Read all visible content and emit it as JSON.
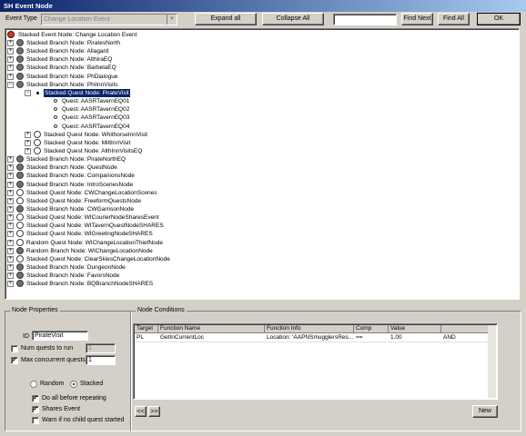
{
  "window": {
    "title": "SH Event Node"
  },
  "toolbar": {
    "event_type_label": "Event Type",
    "event_type_value": "Change Location Event",
    "expand_all": "Expand all",
    "collapse_all": "Collapse All",
    "search_value": "",
    "find_next": "Find Next",
    "find_all": "Find All",
    "ok": "OK"
  },
  "tree": {
    "root": "Stacked Event Node: Change Location Event",
    "items": [
      {
        "label": "Stacked Branch Node: PiratesNorth",
        "level": 1,
        "expander": "+",
        "icon": "filled"
      },
      {
        "label": "Stacked Branch Node: Allagard",
        "level": 1,
        "expander": "+",
        "icon": "filled"
      },
      {
        "label": "Stacked Branch Node: AlthiraEQ",
        "level": 1,
        "expander": "+",
        "icon": "filled"
      },
      {
        "label": "Stacked Branch Node: BarbelaEQ",
        "level": 1,
        "expander": "+",
        "icon": "filled"
      },
      {
        "label": "Stacked Branch Node: PhDialogue",
        "level": 1,
        "expander": "+",
        "icon": "filled"
      },
      {
        "label": "Stacked Branch Node: PhiInnVisits",
        "level": 1,
        "expander": "-",
        "icon": "filled"
      },
      {
        "label": "Stacked Quest Node: PirateVisit",
        "level": 2,
        "expander": "-",
        "icon": "dot",
        "selected": true
      },
      {
        "label": "Quest: AASRTavernEQ01",
        "level": 3,
        "expander": "",
        "icon": "small"
      },
      {
        "label": "Quest: AASRTavernEQ02",
        "level": 3,
        "expander": "",
        "icon": "small"
      },
      {
        "label": "Quest: AASRTavernEQ03",
        "level": 3,
        "expander": "",
        "icon": "small"
      },
      {
        "label": "Quest: AASRTavernEQ04",
        "level": 3,
        "expander": "",
        "icon": "small"
      },
      {
        "label": "Stacked Quest Node: WhithorseInnVisit",
        "level": 2,
        "expander": "+",
        "icon": "empty"
      },
      {
        "label": "Stacked Quest Node: MittInnVisit",
        "level": 2,
        "expander": "+",
        "icon": "empty"
      },
      {
        "label": "Stacked Quest Node: AlthInnVisitsEQ",
        "level": 2,
        "expander": "+",
        "icon": "empty"
      },
      {
        "label": "Stacked Branch Node: PirateNorthEQ",
        "level": 1,
        "expander": "+",
        "icon": "filled"
      },
      {
        "label": "Stacked Branch Node: QuestNode",
        "level": 1,
        "expander": "+",
        "icon": "filled"
      },
      {
        "label": "Stacked Branch Node: CompanionsNode",
        "level": 1,
        "expander": "+",
        "icon": "filled"
      },
      {
        "label": "Stacked Branch Node: IntroScenesNode",
        "level": 1,
        "expander": "+",
        "icon": "filled"
      },
      {
        "label": "Stacked Quest Node: CWChangeLocationScenes",
        "level": 1,
        "expander": "+",
        "icon": "empty"
      },
      {
        "label": "Stacked Quest Node: FreeformQuestsNode",
        "level": 1,
        "expander": "+",
        "icon": "empty"
      },
      {
        "label": "Stacked Branch Node: CWGarrisonNode",
        "level": 1,
        "expander": "+",
        "icon": "filled"
      },
      {
        "label": "Stacked Quest Node: WICourierNodeSharesEvent",
        "level": 1,
        "expander": "+",
        "icon": "empty"
      },
      {
        "label": "Stacked Quest Node: WITavernQuestNodeSHARES",
        "level": 1,
        "expander": "+",
        "icon": "empty"
      },
      {
        "label": "Stacked Quest Node: WIGreetingNodeSHARES",
        "level": 1,
        "expander": "+",
        "icon": "empty"
      },
      {
        "label": "Random Quest Node: WIChangeLocationThiefNode",
        "level": 1,
        "expander": "+",
        "icon": "empty"
      },
      {
        "label": "Random Branch Node: WIChangeLocationNode",
        "level": 1,
        "expander": "+",
        "icon": "filled"
      },
      {
        "label": "Stacked Quest Node: ClearSkiesChangeLocationNode",
        "level": 1,
        "expander": "+",
        "icon": "empty"
      },
      {
        "label": "Stacked Branch Node: DungeonNode",
        "level": 1,
        "expander": "+",
        "icon": "filled"
      },
      {
        "label": "Stacked Branch Node: FavorsNode",
        "level": 1,
        "expander": "+",
        "icon": "filled"
      },
      {
        "label": "Stacked Branch Node: BQBranchNodeSHARES",
        "level": 1,
        "expander": "+",
        "icon": "filled"
      }
    ]
  },
  "node_properties": {
    "group_label": "Node Properties",
    "id_label": "ID",
    "id_value": "PirateVisit",
    "num_quests_label": "Num quests to run",
    "num_quests_value": "1",
    "max_concurrent_label": "Max concurrent quests",
    "max_concurrent_value": "1",
    "random_label": "Random",
    "stacked_label": "Stacked",
    "do_all_label": "Do all before repeating",
    "shares_event_label": "Shares Event",
    "warn_label": "Warn if no child quest started"
  },
  "node_conditions": {
    "group_label": "Node Conditions",
    "headers": [
      "Target",
      "Function Name",
      "Function Info",
      "Comp",
      "Value",
      ""
    ],
    "rows": [
      [
        "PL",
        "GetInCurrentLoc",
        "Location: 'AAPNSmugglersRes...",
        "==",
        "1.00",
        "AND"
      ]
    ],
    "prev_label": "<<",
    "next_label": ">>",
    "new_label": "New"
  },
  "colors": {
    "title_start": "#0a246a",
    "title_end": "#a6caf0",
    "face": "#d4d0c8",
    "selection": "#0a246a"
  }
}
